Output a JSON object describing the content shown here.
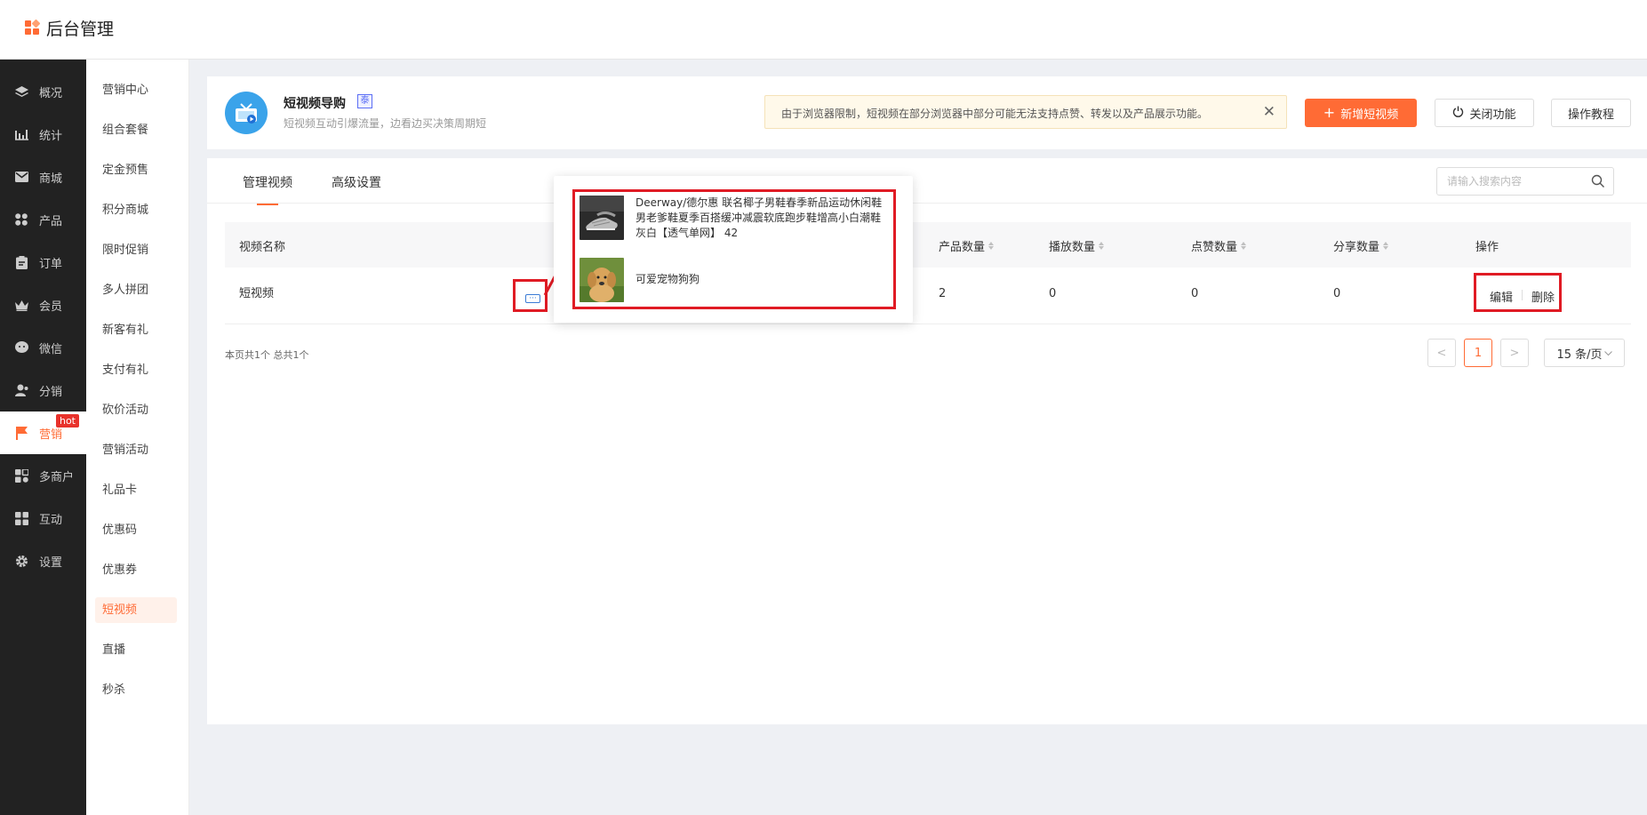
{
  "header": {
    "app_name": "后台管理"
  },
  "sidebar": {
    "items": [
      {
        "label": "概况",
        "icon": "layers-icon"
      },
      {
        "label": "统计",
        "icon": "chart-icon"
      },
      {
        "label": "商城",
        "icon": "mail-icon"
      },
      {
        "label": "产品",
        "icon": "grid-icon"
      },
      {
        "label": "订单",
        "icon": "clipboard-icon"
      },
      {
        "label": "会员",
        "icon": "crown-icon"
      },
      {
        "label": "微信",
        "icon": "wechat-icon"
      },
      {
        "label": "分销",
        "icon": "user-share-icon"
      },
      {
        "label": "营销",
        "icon": "flag-icon",
        "badge": "hot",
        "active": true
      },
      {
        "label": "多商户",
        "icon": "merchant-icon"
      },
      {
        "label": "互动",
        "icon": "interact-icon"
      },
      {
        "label": "设置",
        "icon": "gear-icon"
      }
    ]
  },
  "subnav": {
    "items": [
      "营销中心",
      "组合套餐",
      "定金预售",
      "积分商城",
      "限时促销",
      "多人拼团",
      "新客有礼",
      "支付有礼",
      "砍价活动",
      "营销活动",
      "礼品卡",
      "优惠码",
      "优惠券",
      "短视频",
      "直播",
      "秒杀"
    ],
    "active": "短视频"
  },
  "app": {
    "title": "短视频导购",
    "tag": "泰",
    "subtitle": "短视频互动引爆流量，边看边买决策周期短",
    "notice": "由于浏览器限制，短视频在部分浏览器中部分可能无法支持点赞、转发以及产品展示功能。",
    "btn_add": "新增短视频",
    "btn_close": "关闭功能",
    "btn_tutorial": "操作教程"
  },
  "tabs": [
    "管理视频",
    "高级设置"
  ],
  "search": {
    "placeholder": "请输入搜索内容"
  },
  "table": {
    "columns": [
      "视频名称",
      "产品数量",
      "播放数量",
      "点赞数量",
      "分享数量",
      "操作"
    ],
    "rows": [
      {
        "name": "短视频",
        "products": "2",
        "plays": "0",
        "likes": "0",
        "shares": "0"
      }
    ],
    "actions": {
      "edit": "编辑",
      "delete": "删除"
    }
  },
  "popover": {
    "items": [
      {
        "text": "Deerway/德尔惠 联名椰子男鞋春季新品运动休闲鞋男老爹鞋夏季百搭缓冲减震软底跑步鞋增高小白潮鞋 灰白【透气单网】 42",
        "thumb": "shoe"
      },
      {
        "text": "可爱宠物狗狗",
        "thumb": "dog"
      }
    ]
  },
  "pagination": {
    "info": "本页共1个 总共1个",
    "prev": "<",
    "current": "1",
    "next": ">",
    "page_size": "15 条/页"
  },
  "colors": {
    "accent": "#ff6b35",
    "highlight": "#e01b24",
    "sidebar_bg": "#222222"
  }
}
